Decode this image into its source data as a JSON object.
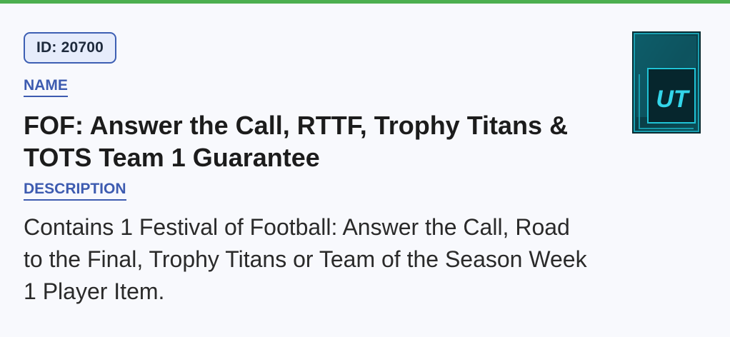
{
  "item": {
    "id_text": "ID: 20700",
    "name_label": "NAME",
    "name": "FOF: Answer the Call, RTTF, Trophy Titans & TOTS Team 1 Guarantee",
    "description_label": "DESCRIPTION",
    "description": "Contains 1 Festival of Football: Answer the Call, Road to the Final, Trophy Titans or Team of the Season Week 1 Player Item.",
    "thumbnail": {
      "icon": "ut-pack-card-icon",
      "text": "UT"
    }
  },
  "colors": {
    "accent_top_bar": "#4caf50",
    "label_blue": "#3d5bb0",
    "badge_bg": "#e6ecfb",
    "card_teal": "#1fc3d6"
  }
}
